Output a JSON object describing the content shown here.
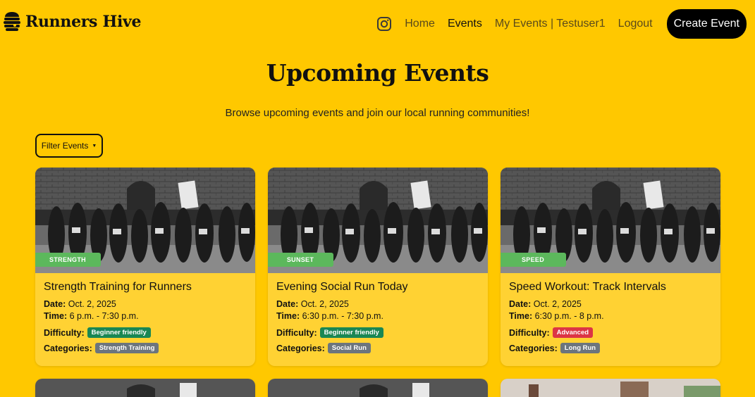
{
  "brand": {
    "name": "Runners Hive",
    "logo_icon": "beehive-icon"
  },
  "nav": {
    "instagram_icon": "instagram-icon",
    "links": [
      "Home",
      "Events",
      "My Events | Testuser1",
      "Logout"
    ],
    "active": "Events",
    "create_label": "Create Event"
  },
  "page": {
    "title": "Upcoming Events",
    "subtitle": "Browse upcoming events and join our local running communities!",
    "filter_label": "Filter Events"
  },
  "labels": {
    "date": "Date:",
    "time": "Time:",
    "difficulty": "Difficulty:",
    "categories": "Categories:"
  },
  "colors": {
    "background": "#FFC800",
    "card": "#FFD233",
    "tag": "#5CB85C",
    "beginner": "#198754",
    "advanced": "#DC3545",
    "category": "#6C757D"
  },
  "events": [
    {
      "tag": "Strength",
      "title": "Strength Training for Runners",
      "date": "Oct. 2, 2025",
      "time": "6 p.m. - 7:30 p.m.",
      "difficulty": "Beginner friendly",
      "difficulty_color": "green",
      "category": "Strength Training"
    },
    {
      "tag": "Sunset",
      "title": "Evening Social Run Today",
      "date": "Oct. 2, 2025",
      "time": "6:30 p.m. - 7:30 p.m.",
      "difficulty": "Beginner friendly",
      "difficulty_color": "green",
      "category": "Social Run"
    },
    {
      "tag": "Speed",
      "title": "Speed Workout: Track Intervals",
      "date": "Oct. 2, 2025",
      "time": "6:30 p.m. - 8 p.m.",
      "difficulty": "Advanced",
      "difficulty_color": "red",
      "category": "Long Run"
    }
  ]
}
